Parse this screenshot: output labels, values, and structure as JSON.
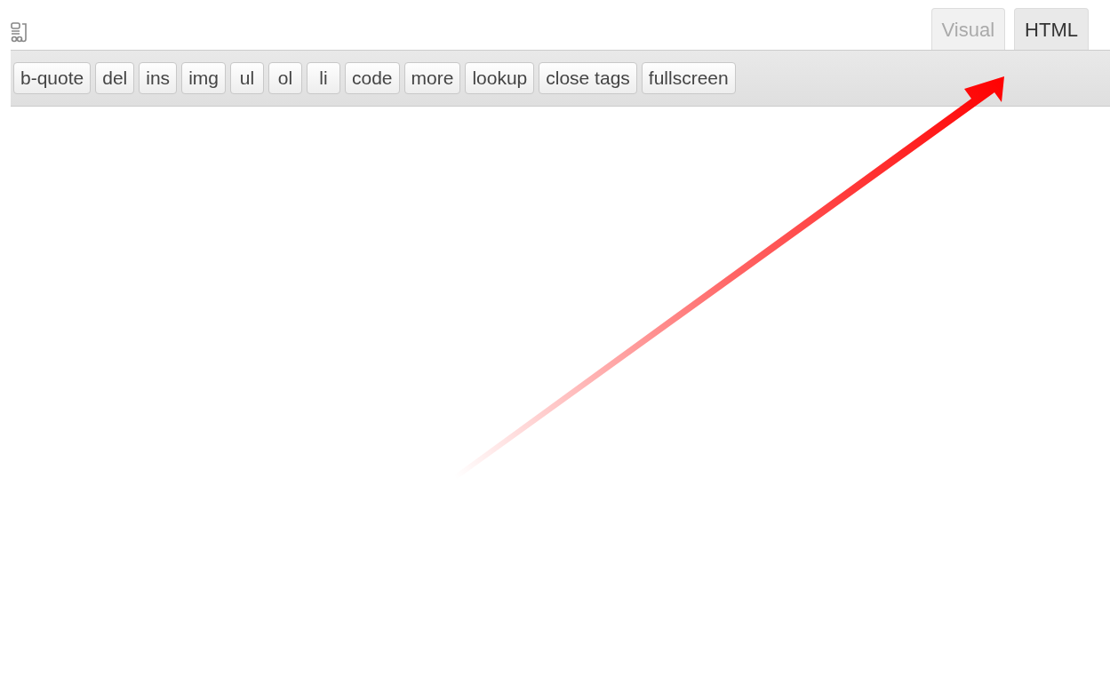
{
  "tabs": [
    {
      "label": "Visual",
      "selected": false
    },
    {
      "label": "HTML",
      "selected": true
    }
  ],
  "toolbar": {
    "buttons": [
      "b-quote",
      "del",
      "ins",
      "img",
      "ul",
      "ol",
      "li",
      "code",
      "more",
      "lookup",
      "close tags",
      "fullscreen"
    ]
  }
}
